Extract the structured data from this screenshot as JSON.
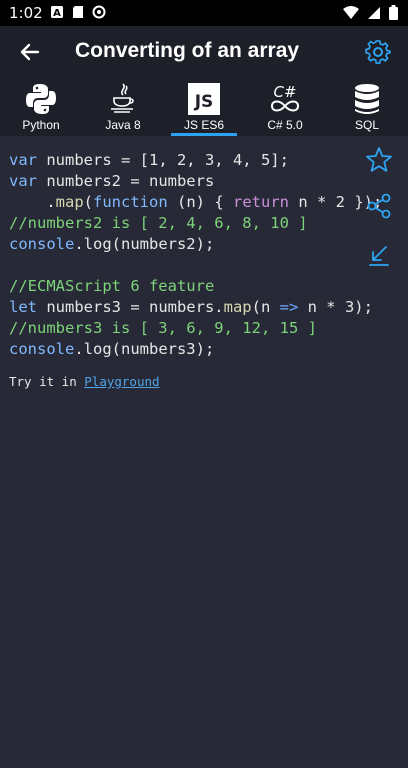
{
  "status": {
    "time": "1:02"
  },
  "appbar": {
    "title": "Converting of an array"
  },
  "tabs": [
    {
      "label": "Python",
      "icon": "python-icon"
    },
    {
      "label": "Java 8",
      "icon": "java-icon"
    },
    {
      "label": "JS ES6",
      "icon": "js-icon",
      "active": true
    },
    {
      "label": "C# 5.0",
      "icon": "csharp-icon"
    },
    {
      "label": "SQL",
      "icon": "database-icon"
    }
  ],
  "code": {
    "line1": [
      "var",
      " numbers = [1, 2, 3, 4, 5];"
    ],
    "line2": [
      "var",
      " numbers2 = numbers"
    ],
    "line3": [
      "    .",
      "map",
      "(",
      "function",
      " (n) { ",
      "return",
      " n * 2 });"
    ],
    "line4": "//numbers2 is [ 2, 4, 6, 8, 10 ]",
    "line5": [
      "console",
      ".log(numbers2);"
    ],
    "line6": "//ECMAScript 6 feature",
    "line7": [
      "let",
      " numbers3 = numbers.",
      "map",
      "(n ",
      "=>",
      " n * 3);"
    ],
    "line8": "//numbers3 is [ 3, 6, 9, 12, 15 ]",
    "line9": [
      "console",
      ".log(numbers3);"
    ]
  },
  "footer": {
    "try_text": "Try it in ",
    "link_label": "Playground"
  },
  "colors": {
    "accent": "#2ea3f2",
    "keyword": "#82b8ff",
    "comment": "#7ed27a",
    "background": "#272a36",
    "bar": "#1e2029"
  }
}
